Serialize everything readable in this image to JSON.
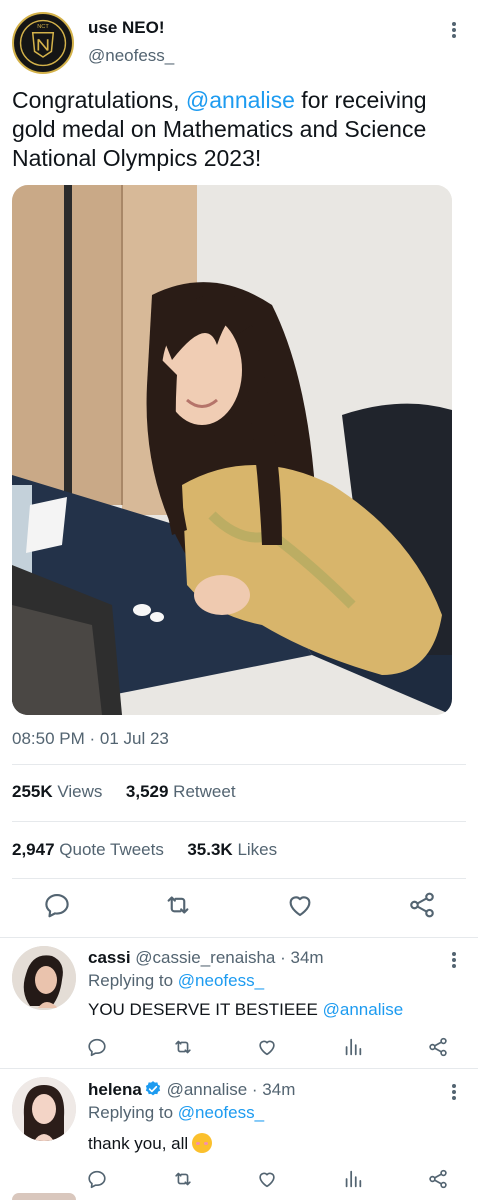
{
  "tweet": {
    "author_name": "use NEO!",
    "author_handle": "@neofess_",
    "text_before": "Congratulations, ",
    "mention": "@annalise",
    "text_after": " for receiving gold medal on Mathematics and Science National Olympics 2023!",
    "timestamp": "08:50 PM · 01 Jul 23",
    "views_count": "255K",
    "views_label": "Views",
    "retweets_count": "3,529",
    "retweets_label": "Retweet",
    "quotes_count": "2,947",
    "quotes_label": "Quote Tweets",
    "likes_count": "35.3K",
    "likes_label": "Likes",
    "logo_text": "NCT",
    "photo_alt": "photo of a smiling girl at a desk"
  },
  "actions": {
    "icons": [
      "reply-icon",
      "retweet-icon",
      "like-icon",
      "share-icon"
    ]
  },
  "replies": [
    {
      "name": "cassi",
      "handle": "@cassie_renaisha",
      "time": "· 34m",
      "replying_prefix": "Replying to ",
      "replying_to": "@neofess_",
      "text": "YOU DESERVE IT BESTIEEE ",
      "text_mention": "@annalise",
      "verified": false
    },
    {
      "name": "helena",
      "handle": "@annalise",
      "time": "· 34m",
      "replying_prefix": "Replying to ",
      "replying_to": "@neofess_",
      "text": "thank you, all",
      "verified": true
    }
  ],
  "colors": {
    "accent": "#1d9bf0",
    "secondary_text": "#536471",
    "primary_text": "#0f1419"
  }
}
